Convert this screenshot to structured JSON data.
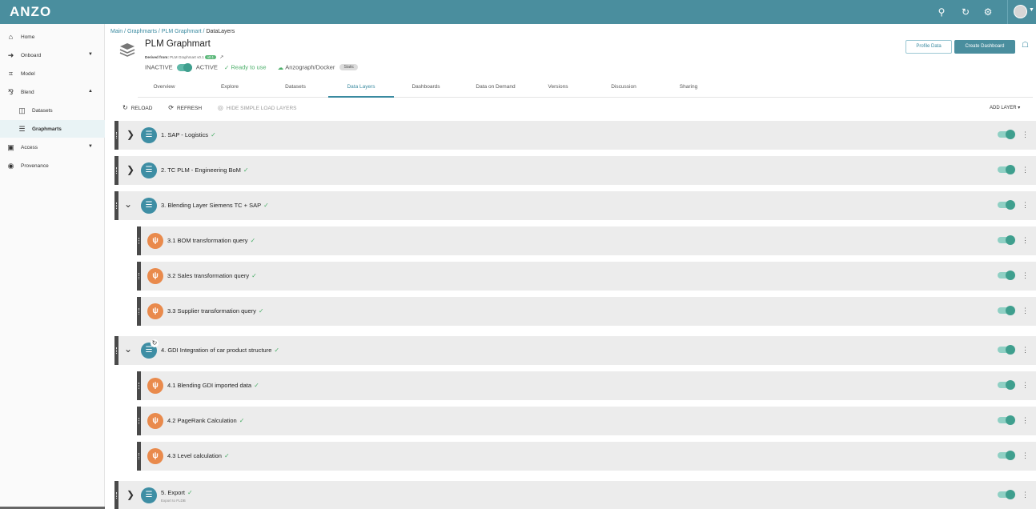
{
  "app": {
    "logo": "ANZO"
  },
  "colors": {
    "brand": "#4a8e9e",
    "success": "#4caf6a",
    "query_icon": "#e98a4c",
    "layer_icon": "#3e8ea4"
  },
  "topbar_icons": [
    "search-icon",
    "history-icon",
    "gear-icon",
    "user-avatar"
  ],
  "sidebar": {
    "items": [
      {
        "label": "Home",
        "icon": "home-icon"
      },
      {
        "label": "Onboard",
        "icon": "onboard-icon"
      },
      {
        "label": "Model",
        "icon": "model-icon"
      },
      {
        "label": "Blend",
        "icon": "blend-icon"
      },
      {
        "label": "Datasets",
        "icon": "dataset-icon"
      },
      {
        "label": "Graphmarts",
        "icon": "graphmart-icon"
      },
      {
        "label": "Access",
        "icon": "access-icon"
      },
      {
        "label": "Provenance",
        "icon": "provenance-icon"
      }
    ]
  },
  "breadcrumb": {
    "path": "Main / Graphmarts / PLM Graphmart / ",
    "current": "DataLayers"
  },
  "graphmart": {
    "title": "PLM Graphmart",
    "derived_label": "Derived from:",
    "derived_value": "PLM Graphmart v0.1",
    "version_badge": "v0.1",
    "inactive": "INACTIVE",
    "active": "ACTIVE",
    "ready": "Ready to use",
    "engine": "Anzograph/Docker",
    "mode": "Static"
  },
  "actions": {
    "profile": "Profile Data",
    "dashboard": "Create Dashboard"
  },
  "tabs": [
    "Overview",
    "Explore",
    "Datasets",
    "Data Layers",
    "Dashboards",
    "Data on Demand",
    "Versions",
    "Discussion",
    "Sharing"
  ],
  "active_tab": "Data Layers",
  "toolbar": {
    "reload": "RELOAD",
    "refresh": "REFRESH",
    "hide": "HIDE SIMPLE LOAD LAYERS",
    "add_layer": "ADD LAYER"
  },
  "layers": [
    {
      "name": "1. SAP - Logistics",
      "kind": "layer",
      "expanded": false,
      "enabled": true
    },
    {
      "name": "2. TC PLM - Engineering BoM",
      "kind": "layer",
      "expanded": false,
      "enabled": true
    },
    {
      "name": "3. Blending Layer Siemens TC + SAP",
      "kind": "layer",
      "expanded": true,
      "enabled": true
    },
    {
      "name": "3.1 BOM transformation query",
      "kind": "query",
      "enabled": true
    },
    {
      "name": "3.2 Sales transformation query",
      "kind": "query",
      "enabled": true
    },
    {
      "name": "3.3 Supplier transformation query",
      "kind": "query",
      "enabled": true
    },
    {
      "name": "4. GDI Integration of car product structure",
      "kind": "layer",
      "expanded": true,
      "enabled": true
    },
    {
      "name": "4.1 Blending GDI imported data",
      "kind": "query",
      "enabled": true
    },
    {
      "name": "4.2 PageRank Calculation",
      "kind": "query",
      "enabled": true
    },
    {
      "name": "4.3 Level calculation",
      "kind": "query",
      "enabled": true
    },
    {
      "name": "5. Export",
      "kind": "layer",
      "expanded": false,
      "enabled": true,
      "subtitle": "Export to FLDB"
    }
  ]
}
